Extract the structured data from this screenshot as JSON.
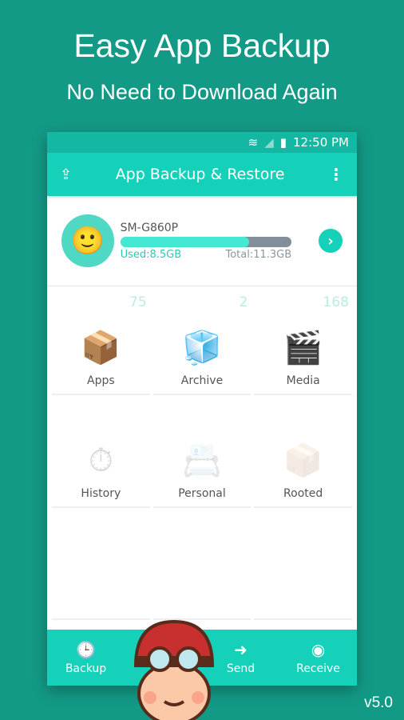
{
  "promo": {
    "title": "Easy App Backup",
    "subtitle": "No Need to Download Again",
    "version": "v5.0"
  },
  "status": {
    "time": "12:50 PM"
  },
  "appbar": {
    "title": "App Backup & Restore",
    "share_icon": "share-icon",
    "menu_icon": "more-vert-icon"
  },
  "device": {
    "name": "SM-G860P",
    "used": "Used:8.5GB",
    "total": "Total:11.3GB",
    "used_fraction": 0.75
  },
  "grid": [
    {
      "label": "Apps",
      "count": "75",
      "icon": "📦"
    },
    {
      "label": "Archive",
      "count": "2",
      "icon": "🧊"
    },
    {
      "label": "Media",
      "count": "168",
      "icon": "🎬"
    },
    {
      "label": "History",
      "count": "",
      "icon": "⏱"
    },
    {
      "label": "Personal",
      "count": "",
      "icon": "📇"
    },
    {
      "label": "Rooted",
      "count": "",
      "icon": "📦"
    },
    {
      "label": "",
      "count": "",
      "icon": ""
    },
    {
      "label": "",
      "count": "",
      "icon": ""
    },
    {
      "label": "",
      "count": "",
      "icon": ""
    }
  ],
  "bottom": [
    {
      "label": "Backup",
      "icon": "🕒"
    },
    {
      "label": "",
      "icon": ""
    },
    {
      "label": "Send",
      "icon": "➜"
    },
    {
      "label": "Receive",
      "icon": "◉"
    }
  ],
  "colors": {
    "accent": "#16d1ba",
    "background": "#139a86"
  }
}
